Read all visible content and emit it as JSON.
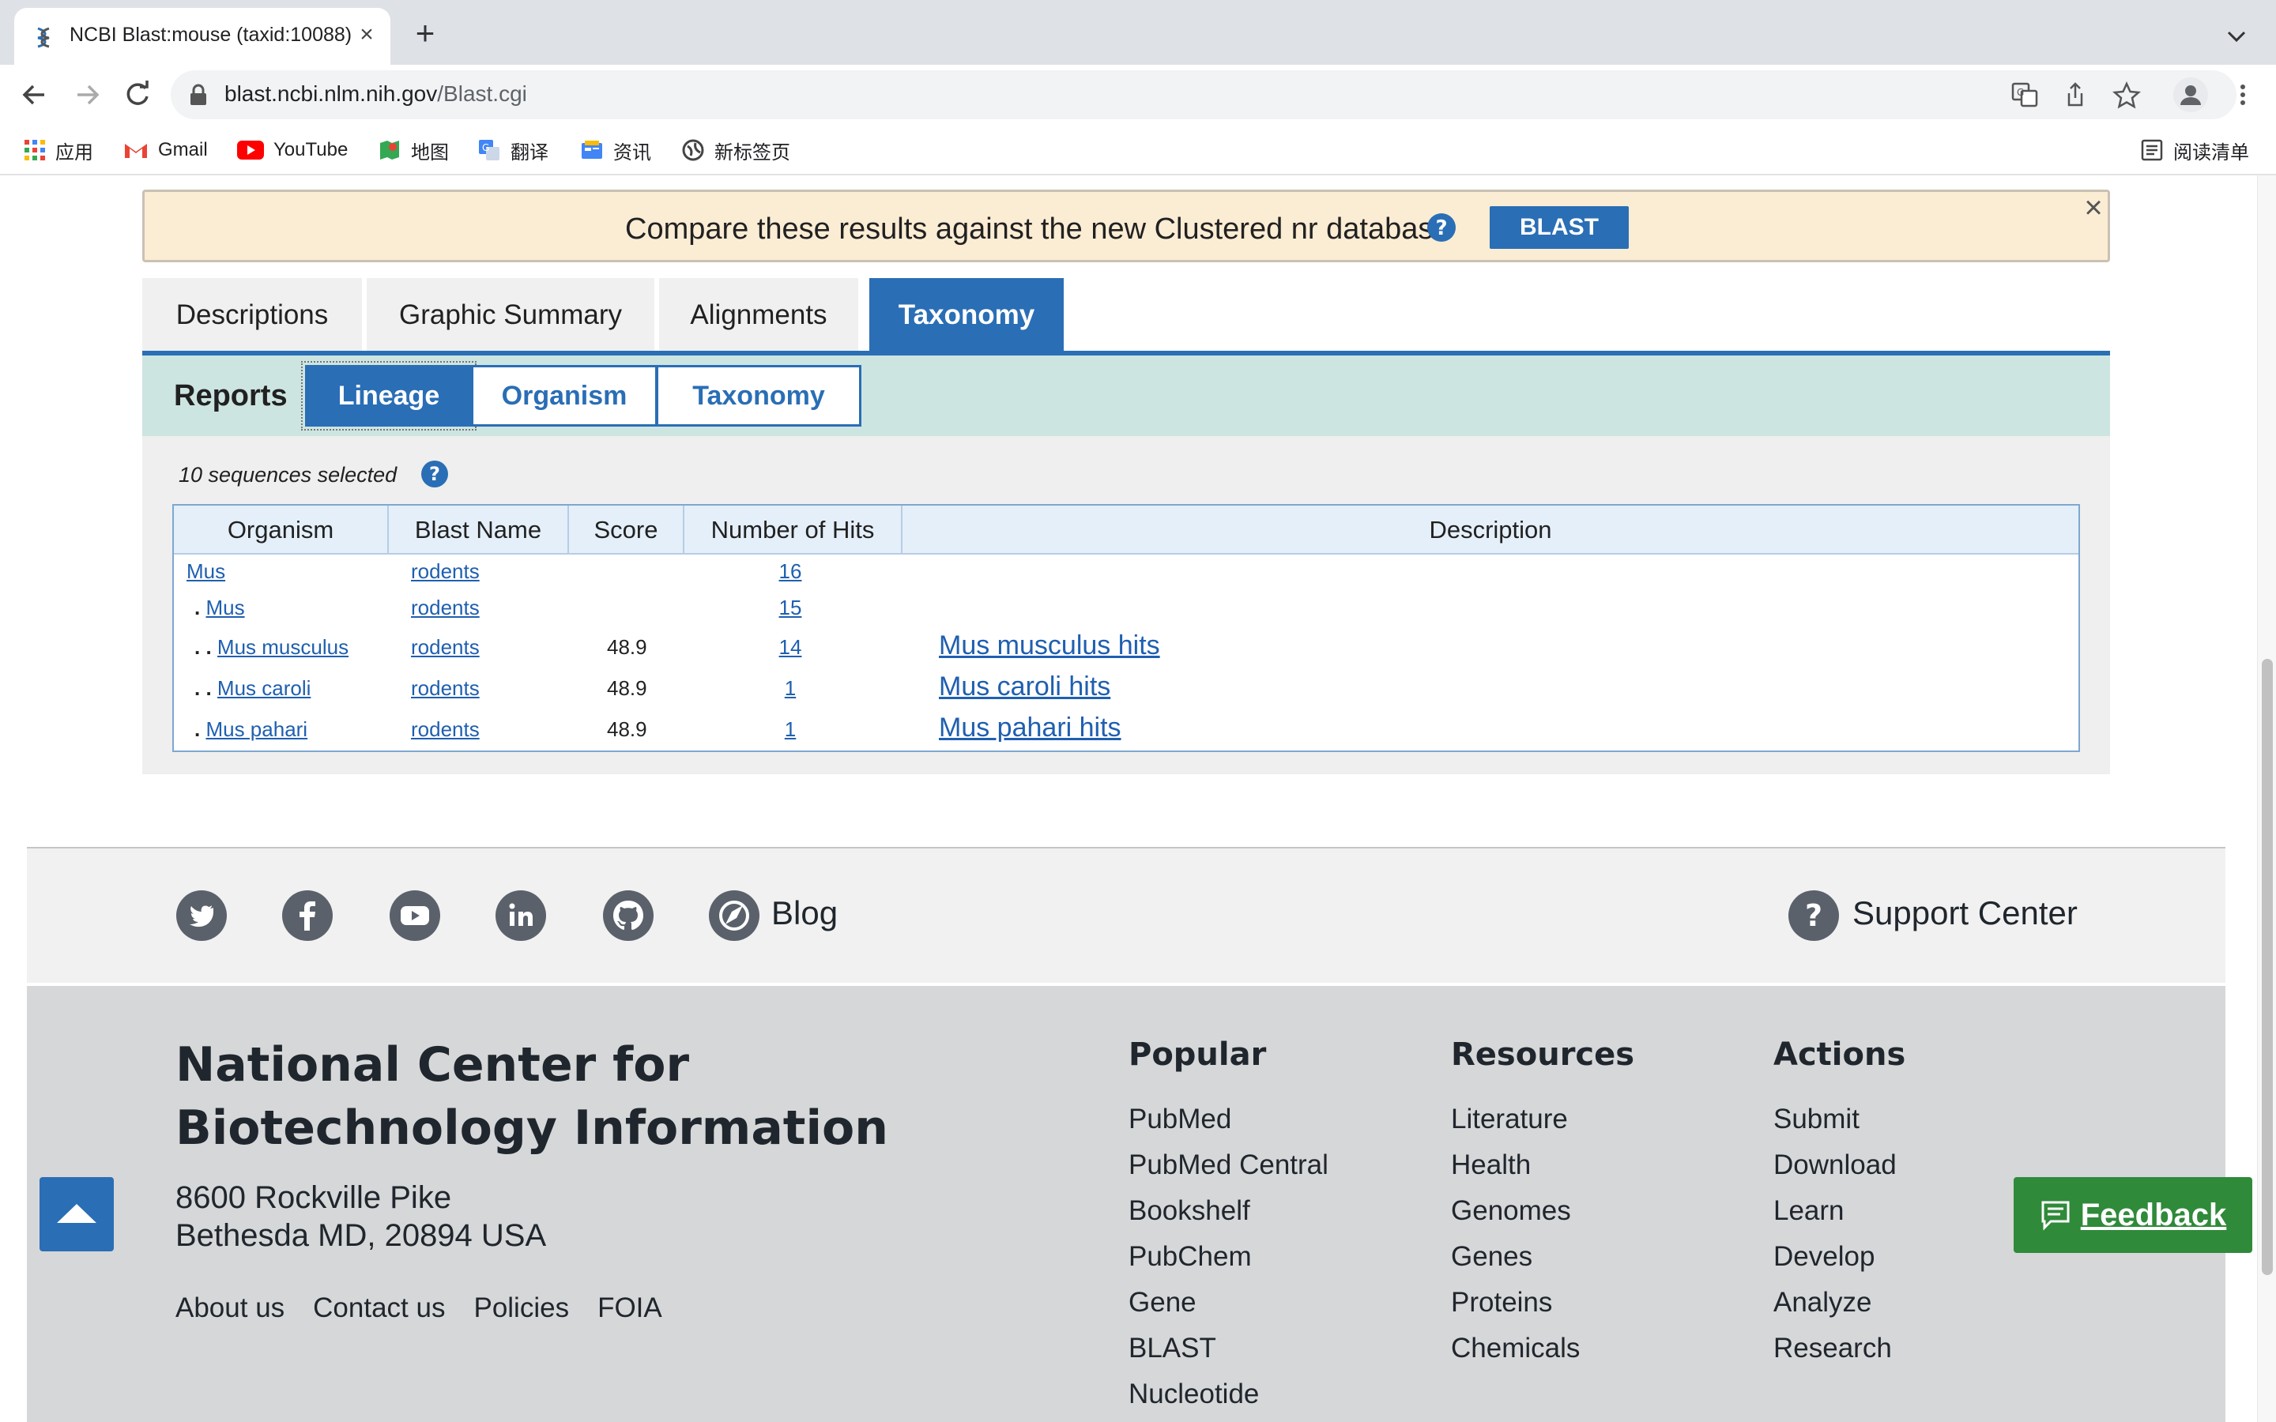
{
  "browser": {
    "tab_title": "NCBI Blast:mouse (taxid:10088)",
    "url_domain": "blast.ncbi.nlm.nih.gov",
    "url_path": "/Blast.cgi",
    "bookmarks": [
      "应用",
      "Gmail",
      "YouTube",
      "地图",
      "翻译",
      "资讯",
      "新标签页"
    ],
    "reading_list": "阅读清单"
  },
  "banner": {
    "text": "Compare these results against the new Clustered nr database",
    "button": "BLAST"
  },
  "tabs": {
    "descriptions": "Descriptions",
    "graphic_summary": "Graphic Summary",
    "alignments": "Alignments",
    "taxonomy": "Taxonomy",
    "active": "Taxonomy"
  },
  "reports": {
    "label": "Reports",
    "lineage": "Lineage",
    "organism": "Organism",
    "taxonomy": "Taxonomy",
    "active": "Lineage"
  },
  "selection": {
    "text": "10 sequences selected"
  },
  "table": {
    "headers": {
      "organism": "Organism",
      "blast_name": "Blast Name",
      "score": "Score",
      "hits": "Number of Hits",
      "description": "Description"
    },
    "rows": [
      {
        "dots": "",
        "organism": "Mus",
        "blast_name": "rodents",
        "score": "",
        "hits": "16",
        "description": ""
      },
      {
        "dots": ".",
        "organism": "Mus",
        "blast_name": "rodents",
        "score": "",
        "hits": "15",
        "description": ""
      },
      {
        "dots": ". .",
        "organism": "Mus musculus",
        "blast_name": "rodents",
        "score": "48.9",
        "hits": "14",
        "description": "Mus musculus hits"
      },
      {
        "dots": ". .",
        "organism": "Mus caroli",
        "blast_name": "rodents",
        "score": "48.9",
        "hits": "1",
        "description": "Mus caroli hits"
      },
      {
        "dots": ".",
        "organism": "Mus pahari",
        "blast_name": "rodents",
        "score": "48.9",
        "hits": "1",
        "description": "Mus pahari hits"
      }
    ]
  },
  "footer": {
    "social_icons": [
      "twitter-icon",
      "facebook-icon",
      "youtube-icon",
      "linkedin-icon",
      "github-icon",
      "blog-icon"
    ],
    "blog": "Blog",
    "support": "Support Center",
    "org_name": "National Center for Biotechnology Information",
    "address_line1": "8600 Rockville Pike",
    "address_line2": "Bethesda MD, 20894 USA",
    "links": [
      "About us",
      "Contact us",
      "Policies",
      "FOIA"
    ],
    "popular": {
      "title": "Popular",
      "items": [
        "PubMed",
        "PubMed Central",
        "Bookshelf",
        "PubChem",
        "Gene",
        "BLAST",
        "Nucleotide"
      ]
    },
    "resources": {
      "title": "Resources",
      "items": [
        "Literature",
        "Health",
        "Genomes",
        "Genes",
        "Proteins",
        "Chemicals"
      ]
    },
    "actions": {
      "title": "Actions",
      "items": [
        "Submit",
        "Download",
        "Learn",
        "Develop",
        "Analyze",
        "Research"
      ]
    },
    "feedback": "Feedback"
  },
  "colors": {
    "ncbi_blue": "#2a6eb5",
    "link_blue": "#1f5fb0",
    "banner_bg": "#fbecd4",
    "reports_bg": "#cde5e1",
    "feedback_green": "#2f8a3a"
  }
}
